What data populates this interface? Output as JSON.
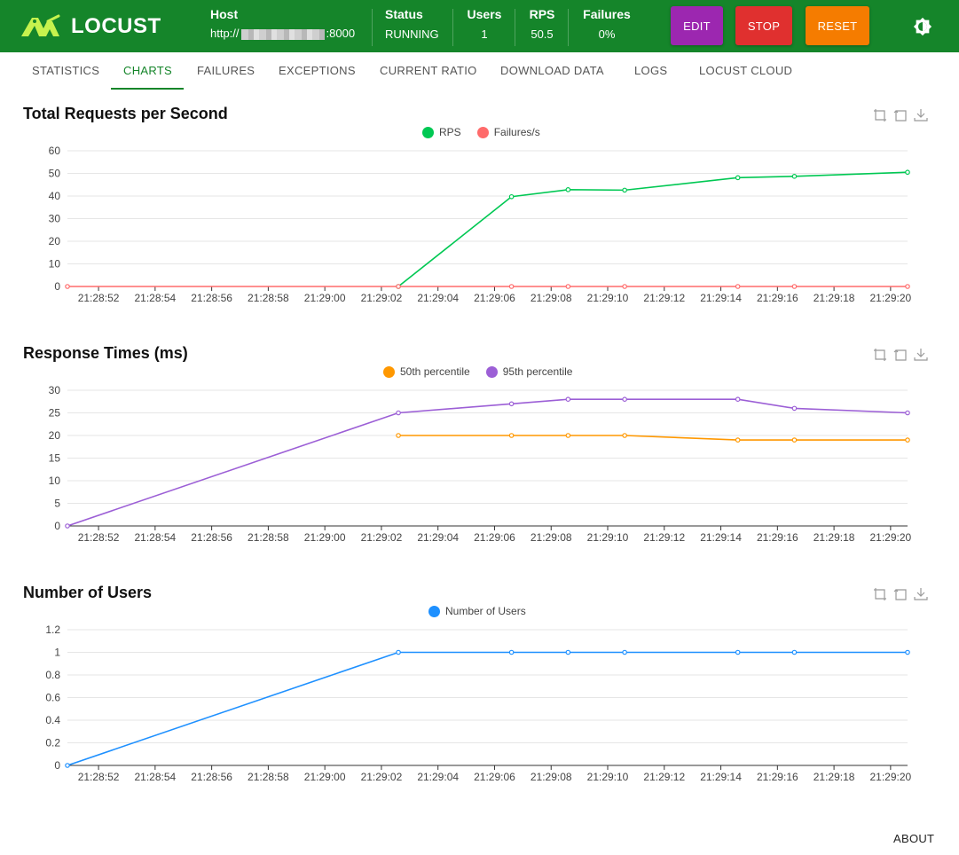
{
  "app": {
    "name": "LOCUST"
  },
  "header": {
    "host_label": "Host",
    "host_prefix": "http://",
    "host_suffix": ":8000",
    "status_label": "Status",
    "status_value": "RUNNING",
    "users_label": "Users",
    "users_value": "1",
    "rps_label": "RPS",
    "rps_value": "50.5",
    "failures_label": "Failures",
    "failures_value": "0%",
    "buttons": {
      "edit": "EDIT",
      "stop": "STOP",
      "reset": "RESET"
    },
    "colors": {
      "nav": "#15852a",
      "edit": "#9c27b0",
      "stop": "#e0302f",
      "reset": "#f57c00"
    }
  },
  "tabs": [
    "STATISTICS",
    "CHARTS",
    "FAILURES",
    "EXCEPTIONS",
    "CURRENT RATIO",
    "DOWNLOAD DATA",
    "LOGS",
    "LOCUST CLOUD"
  ],
  "active_tab": "CHARTS",
  "toolbox_icons": [
    "zoom-icon",
    "restore-icon",
    "download-icon"
  ],
  "footer": {
    "about": "ABOUT"
  },
  "chart_data": [
    {
      "type": "line",
      "title": "Total Requests per Second",
      "x_ticks": [
        "21:28:52",
        "21:28:54",
        "21:28:56",
        "21:28:58",
        "21:29:00",
        "21:29:02",
        "21:29:04",
        "21:29:06",
        "21:29:08",
        "21:29:10",
        "21:29:12",
        "21:29:14",
        "21:29:16",
        "21:29:18",
        "21:29:20"
      ],
      "y_ticks": [
        "0",
        "10",
        "20",
        "30",
        "40",
        "50",
        "60"
      ],
      "ylim": [
        0,
        60
      ],
      "series": [
        {
          "name": "RPS",
          "color": "#00c853",
          "points": [
            [
              "21:29:02.6",
              0
            ],
            [
              "21:29:06.6",
              39.7
            ],
            [
              "21:29:08.6",
              42.8
            ],
            [
              "21:29:10.6",
              42.6
            ],
            [
              "21:29:14.6",
              48.1
            ],
            [
              "21:29:16.6",
              48.7
            ],
            [
              "21:29:20.6",
              50.5
            ]
          ]
        },
        {
          "name": "Failures/s",
          "color": "#ff6b6b",
          "points": [
            [
              "21:28:50.9",
              0
            ],
            [
              "21:29:02.6",
              0
            ],
            [
              "21:29:06.6",
              0
            ],
            [
              "21:29:08.6",
              0
            ],
            [
              "21:29:10.6",
              0
            ],
            [
              "21:29:14.6",
              0
            ],
            [
              "21:29:16.6",
              0
            ],
            [
              "21:29:20.6",
              0
            ]
          ]
        }
      ],
      "legend": "top-center",
      "grid": true
    },
    {
      "type": "line",
      "title": "Response Times (ms)",
      "x_ticks": [
        "21:28:52",
        "21:28:54",
        "21:28:56",
        "21:28:58",
        "21:29:00",
        "21:29:02",
        "21:29:04",
        "21:29:06",
        "21:29:08",
        "21:29:10",
        "21:29:12",
        "21:29:14",
        "21:29:16",
        "21:29:18",
        "21:29:20"
      ],
      "y_ticks": [
        "0",
        "5",
        "10",
        "15",
        "20",
        "25",
        "30"
      ],
      "ylim": [
        0,
        30
      ],
      "series": [
        {
          "name": "50th percentile",
          "color": "#ff9800",
          "points": [
            [
              "21:29:02.6",
              20
            ],
            [
              "21:29:06.6",
              20
            ],
            [
              "21:29:08.6",
              20
            ],
            [
              "21:29:10.6",
              20
            ],
            [
              "21:29:14.6",
              19
            ],
            [
              "21:29:16.6",
              19
            ],
            [
              "21:29:20.6",
              19
            ]
          ]
        },
        {
          "name": "95th percentile",
          "color": "#9c5fd6",
          "points": [
            [
              "21:28:50.9",
              0
            ],
            [
              "21:29:02.6",
              25
            ],
            [
              "21:29:06.6",
              27
            ],
            [
              "21:29:08.6",
              28
            ],
            [
              "21:29:10.6",
              28
            ],
            [
              "21:29:14.6",
              28
            ],
            [
              "21:29:16.6",
              26
            ],
            [
              "21:29:20.6",
              25
            ]
          ]
        }
      ],
      "legend": "top-center",
      "grid": true
    },
    {
      "type": "line",
      "title": "Number of Users",
      "x_ticks": [
        "21:28:52",
        "21:28:54",
        "21:28:56",
        "21:28:58",
        "21:29:00",
        "21:29:02",
        "21:29:04",
        "21:29:06",
        "21:29:08",
        "21:29:10",
        "21:29:12",
        "21:29:14",
        "21:29:16",
        "21:29:18",
        "21:29:20"
      ],
      "y_ticks": [
        "0",
        "0.2",
        "0.4",
        "0.6",
        "0.8",
        "1",
        "1.2"
      ],
      "ylim": [
        0,
        1.2
      ],
      "series": [
        {
          "name": "Number of Users",
          "color": "#1e90ff",
          "points": [
            [
              "21:28:50.9",
              0
            ],
            [
              "21:29:02.6",
              1
            ],
            [
              "21:29:06.6",
              1
            ],
            [
              "21:29:08.6",
              1
            ],
            [
              "21:29:10.6",
              1
            ],
            [
              "21:29:14.6",
              1
            ],
            [
              "21:29:16.6",
              1
            ],
            [
              "21:29:20.6",
              1
            ]
          ]
        }
      ],
      "legend": "top-center",
      "grid": true
    }
  ]
}
